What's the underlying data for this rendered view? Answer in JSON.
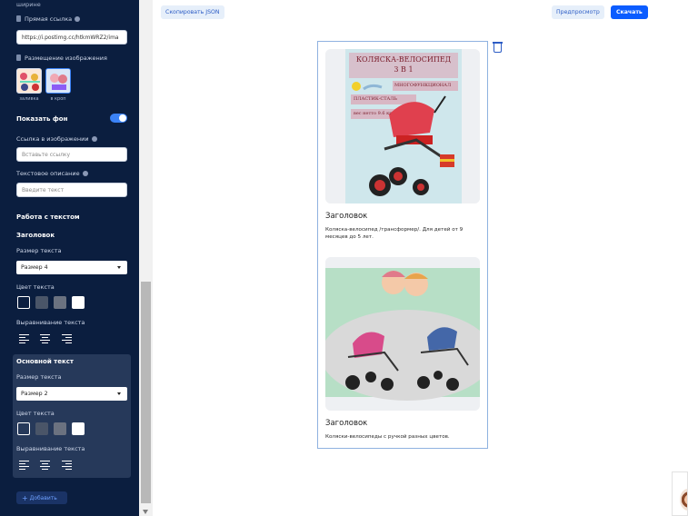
{
  "sidebar": {
    "top_text": "ширине",
    "direct_link_label": "Прямая ссылка",
    "direct_link_value": "https://i.postimg.cc/htkmWRZ2/ima",
    "image_placement_label": "Размещение изображения",
    "placement_options": [
      {
        "label": "заливка"
      },
      {
        "label": "в кроп"
      }
    ],
    "show_background_label": "Показать фон",
    "image_link_label": "Ссылка в изображении",
    "image_link_placeholder": "Вставьте ссылку",
    "text_description_label": "Текстовое описание",
    "text_description_placeholder": "Введите текст",
    "text_work_title": "Работа с текстом",
    "heading_section": {
      "title": "Заголовок",
      "text_size_label": "Размер текста",
      "text_size_value": "Размер 4",
      "text_color_label": "Цвет текста",
      "align_label": "Выравнивание текста"
    },
    "body_section": {
      "title": "Основной текст",
      "text_size_label": "Размер текста",
      "text_size_value": "Размер 2",
      "text_color_label": "Цвет текста",
      "align_label": "Выравнивание текста"
    },
    "add_button": "Добавить",
    "colors": [
      "#0b1e3f",
      "#4a5568",
      "#6b7280",
      "#ffffff"
    ]
  },
  "toolbar": {
    "copy_json": "Скопировать JSON",
    "preview": "Предпросмотр",
    "download": "Скачать"
  },
  "cards": [
    {
      "image_title_line1": "КОЛЯСКА-ВЕЛОСИПЕД",
      "image_title_line2": "3 В 1",
      "badge_multi": "МНОГОФУНКЦИОНАЛ",
      "badge_material": "ПЛАСТИК-СТАЛЬ",
      "badge_weight": "вес нетто 9.6 кг",
      "heading": "Заголовок",
      "description": "Коляска-велосипед /трансформер/. Для детей от 9 месяцев до 5 лет."
    },
    {
      "heading": "Заголовок",
      "description": "Коляски-велосипеды с ручкой разных цветов."
    }
  ],
  "accent_color": "#0b5cff"
}
